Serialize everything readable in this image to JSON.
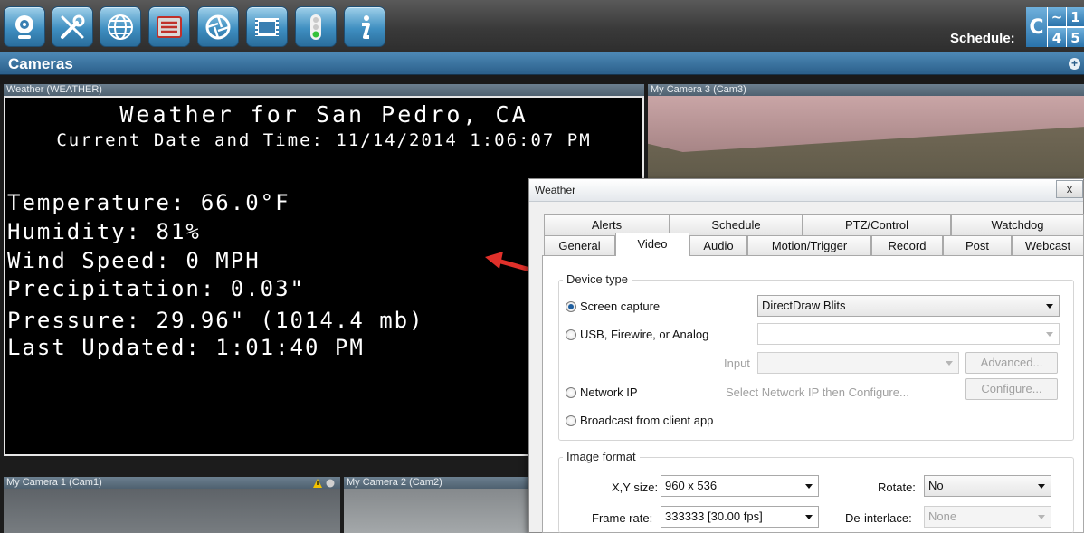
{
  "toolbar": {
    "buttons": [
      {
        "name": "webcam-icon"
      },
      {
        "name": "tools-icon"
      },
      {
        "name": "globe-icon"
      },
      {
        "name": "list-icon"
      },
      {
        "name": "aperture-icon"
      },
      {
        "name": "film-icon"
      },
      {
        "name": "traffic-light-icon"
      },
      {
        "name": "info-icon"
      }
    ],
    "schedule_label": "Schedule:",
    "schedule_glyphs": {
      "c": "C",
      "tilde": "~",
      "one": "1",
      "four": "4",
      "five": "5"
    }
  },
  "cameras_header": {
    "title": "Cameras",
    "expand": "+"
  },
  "panes": {
    "weather": {
      "title": "Weather (WEATHER)",
      "heading": "Weather for San Pedro, CA",
      "datetime": "Current Date and Time: 11/14/2014 1:06:07 PM",
      "lines": [
        "Temperature:  66.0°F",
        "Humidity: 81%",
        "Wind Speed: 0 MPH",
        "Precipitation: 0.03\"",
        "Pressure: 29.96\" (1014.4 mb)",
        "Last Updated: 1:01:40 PM"
      ]
    },
    "cam3": {
      "title": "My Camera 3 (Cam3)"
    },
    "cam1": {
      "title": "My Camera 1 (Cam1)"
    },
    "cam2": {
      "title": "My Camera 2 (Cam2)"
    }
  },
  "dialog": {
    "title": "Weather",
    "close": "x",
    "tabs_row1": [
      "Alerts",
      "Schedule",
      "PTZ/Control",
      "Watchdog"
    ],
    "tabs_row2": [
      "General",
      "Video",
      "Audio",
      "Motion/Trigger",
      "Record",
      "Post",
      "Webcast"
    ],
    "active_tab": "Video",
    "device_type": {
      "title": "Device type",
      "screen_capture": "Screen capture",
      "screen_capture_value": "DirectDraw Blits",
      "usb": "USB, Firewire, or Analog",
      "input_label": "Input",
      "advanced_button": "Advanced...",
      "network_ip": "Network IP",
      "network_hint": "Select Network IP then Configure...",
      "configure_button": "Configure...",
      "broadcast": "Broadcast from client app",
      "selected": "Screen capture"
    },
    "image_format": {
      "title": "Image format",
      "xy_label": "X,Y size:",
      "xy_value": "960 x 536",
      "rotate_label": "Rotate:",
      "rotate_value": "No",
      "frame_rate_label": "Frame rate:",
      "frame_rate_value": "333333 [30.00 fps]",
      "deinterlace_label": "De-interlace:",
      "deinterlace_value": "None"
    }
  },
  "colors": {
    "accent": "#2b5f8a",
    "arrow": "#e0302a",
    "warning": "#f2c200"
  }
}
